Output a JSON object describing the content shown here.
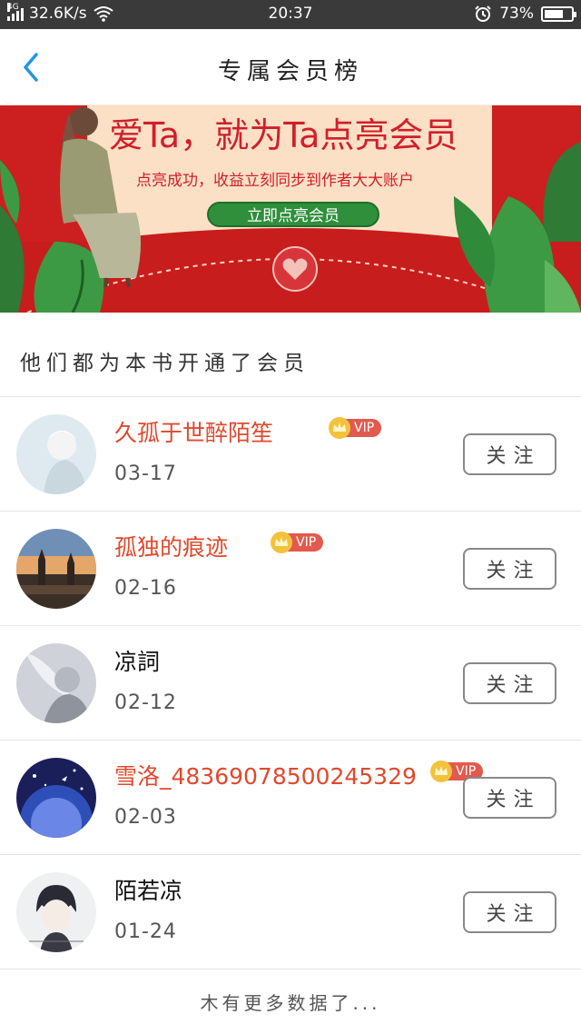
{
  "status_bar": {
    "network": "4G",
    "speed": "32.6K/s",
    "time": "20:37",
    "battery": "73%",
    "battery_level": 0.73
  },
  "header": {
    "title": "专属会员榜",
    "back_icon": "chevron-left-icon"
  },
  "banner": {
    "heading": "爱Ta，就为Ta点亮会员",
    "subtitle": "点亮成功，收益立刻同步到作者大大账户",
    "button": "立即点亮会员",
    "colors": {
      "background": "#cc1f1f",
      "paper": "#fbe0c6",
      "button": "#2f8f3b"
    }
  },
  "section_title": "他们都为本书开通了会员",
  "members": [
    {
      "name": "久孤于世醉陌笙",
      "vip": true,
      "date": "03-17",
      "follow": "关注",
      "avatar": "avatar-pale-figure"
    },
    {
      "name": "孤独的痕迹",
      "vip": true,
      "date": "02-16",
      "follow": "关注",
      "avatar": "avatar-city-skyline"
    },
    {
      "name": "凉詞",
      "vip": false,
      "date": "02-12",
      "follow": "关注",
      "avatar": "avatar-grey-figure"
    },
    {
      "name": "雪洛_48369078500245329",
      "vip": true,
      "date": "02-03",
      "follow": "关注",
      "avatar": "avatar-night-sky"
    },
    {
      "name": "陌若凉",
      "vip": false,
      "date": "01-24",
      "follow": "关注",
      "avatar": "avatar-anime-boy"
    }
  ],
  "vip_label": "VIP",
  "footer": "木有更多数据了..."
}
